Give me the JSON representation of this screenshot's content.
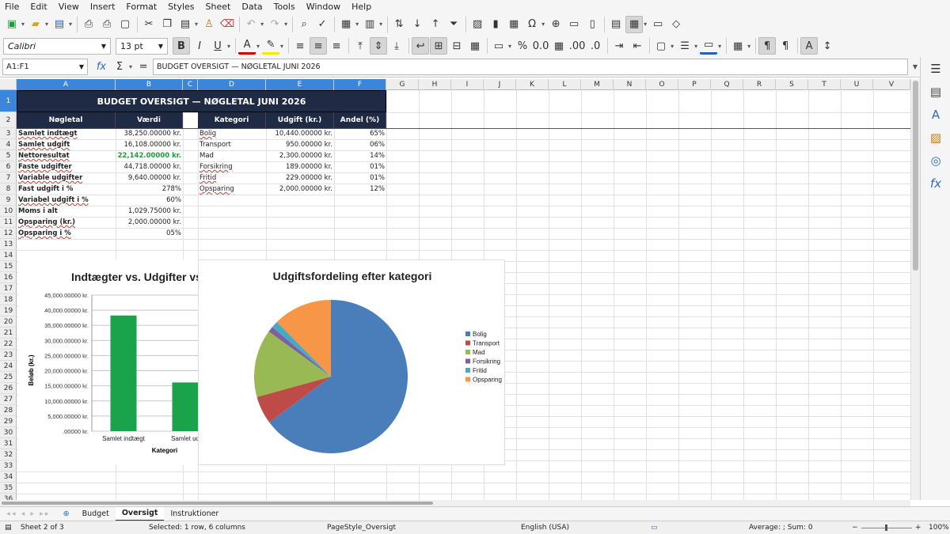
{
  "menu": [
    "File",
    "Edit",
    "View",
    "Insert",
    "Format",
    "Styles",
    "Sheet",
    "Data",
    "Tools",
    "Window",
    "Help"
  ],
  "font": {
    "name": "Calibri",
    "size": "13 pt"
  },
  "namebox": "A1:F1",
  "formula": "BUDGET OVERSIGT — NØGLETAL JUNI 2026",
  "columns": [
    "A",
    "B",
    "C",
    "D",
    "E",
    "F",
    "G",
    "H",
    "I",
    "J",
    "K",
    "L",
    "M",
    "N",
    "O",
    "P",
    "Q",
    "R",
    "S",
    "T",
    "U",
    "V"
  ],
  "rows": [
    "1",
    "2",
    "3",
    "4",
    "5",
    "6",
    "7",
    "8",
    "9",
    "10",
    "11",
    "12",
    "13",
    "14",
    "15",
    "16",
    "17",
    "18",
    "19",
    "20",
    "21",
    "22",
    "23",
    "24",
    "25",
    "26",
    "27",
    "28",
    "29",
    "30",
    "31",
    "32",
    "33",
    "34",
    "35",
    "36"
  ],
  "sheet": {
    "title": "BUDGET OVERSIGT — NØGLETAL JUNI 2026",
    "headers": [
      "Nøgletal",
      "Værdi",
      "Kategori",
      "Udgift (kr.)",
      "Andel (%)"
    ],
    "left": [
      {
        "label": "Samlet indtægt",
        "value": "38,250.00000 kr."
      },
      {
        "label": "Samlet udgift",
        "value": "16,108.00000 kr."
      },
      {
        "label": "Nettoresultat",
        "value": "22,142.00000 kr."
      },
      {
        "label": "Faste udgifter",
        "value": "44,718.00000 kr."
      },
      {
        "label": "Variable udgifter",
        "value": "9,640.00000 kr."
      },
      {
        "label": "Fast udgift i %",
        "value": "278%"
      },
      {
        "label": "Variabel udgift i %",
        "value": "60%"
      },
      {
        "label": "Moms i alt",
        "value": "1,029.75000 kr."
      },
      {
        "label": "Opsparing (kr.)",
        "value": "2,000.00000 kr."
      },
      {
        "label": "Opsparing i %",
        "value": "05%"
      }
    ],
    "right": [
      {
        "cat": "Bolig",
        "amount": "10,440.00000 kr.",
        "share": "65%"
      },
      {
        "cat": "Transport",
        "amount": "950.00000 kr.",
        "share": "06%"
      },
      {
        "cat": "Mad",
        "amount": "2,300.00000 kr.",
        "share": "14%"
      },
      {
        "cat": "Forsikring",
        "amount": "189.00000 kr.",
        "share": "01%"
      },
      {
        "cat": "Fritid",
        "amount": "229.00000 kr.",
        "share": "01%"
      },
      {
        "cat": "Opsparing",
        "amount": "2,000.00000 kr.",
        "share": "12%"
      }
    ]
  },
  "chart_data": [
    {
      "type": "bar",
      "title": "Indtægter vs. Udgifter vs.",
      "xlabel": "Kategori",
      "ylabel": "Beløb (kr.)",
      "categories": [
        "Samlet indtægt",
        "Samlet ud"
      ],
      "values": [
        38250,
        16108
      ],
      "ylim": [
        0,
        45000
      ],
      "yticks": [
        "45,000.00000 kr.",
        "40,000.00000 kr.",
        "35,000.00000 kr.",
        "30,000.00000 kr.",
        "25,000.00000 kr.",
        "20,000.00000 kr.",
        "15,000.00000 kr.",
        "10,000.00000 kr.",
        "5,000.00000 kr.",
        ".00000 kr."
      ],
      "color": "#1aa34a",
      "grid": true
    },
    {
      "type": "pie",
      "title": "Udgiftsfordeling efter kategori",
      "legend_position": "right",
      "slices": [
        {
          "label": "Bolig",
          "value": 10440,
          "color": "#4a7ebb"
        },
        {
          "label": "Transport",
          "value": 950,
          "color": "#be4b48"
        },
        {
          "label": "Mad",
          "value": 2300,
          "color": "#98b954"
        },
        {
          "label": "Forsikring",
          "value": 189,
          "color": "#7d60a0"
        },
        {
          "label": "Fritid",
          "value": 229,
          "color": "#46aac5"
        },
        {
          "label": "Opsparing",
          "value": 2000,
          "color": "#f79646"
        }
      ]
    }
  ],
  "tabs": [
    "Budget",
    "Oversigt",
    "Instruktioner"
  ],
  "status": {
    "sheet": "Sheet 2 of 3",
    "selection": "Selected: 1 row, 6 columns",
    "pagestyle": "PageStyle_Oversigt",
    "lang": "English (USA)",
    "sum": "Average: ; Sum: 0",
    "zoom": "100%"
  }
}
